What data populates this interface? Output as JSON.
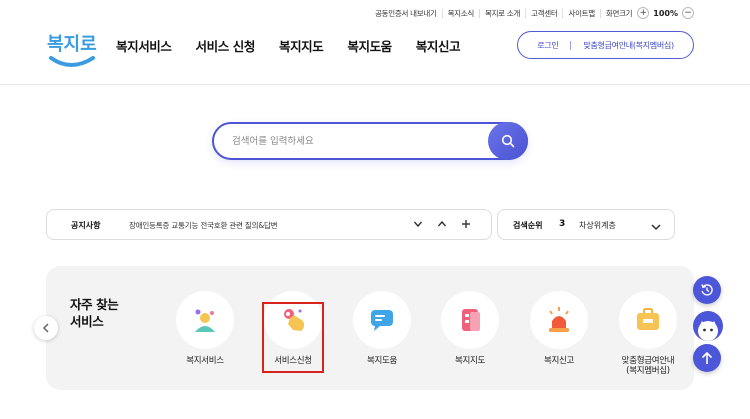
{
  "utility": {
    "links": [
      "공동인증서 내보내기",
      "복지소식",
      "복지로 소개",
      "고객센터",
      "사이트맵"
    ],
    "zoom_label": "화면크기",
    "zoom_plus": "+",
    "zoom_value": "100%",
    "zoom_minus": "−"
  },
  "header": {
    "logo_text": "복지로",
    "nav": [
      "복지서비스",
      "서비스 신청",
      "복지지도",
      "복지도움",
      "복지신고"
    ],
    "login": "로그인",
    "membership": "맞춤형급여안내(복지멤버십)"
  },
  "search": {
    "placeholder": "검색어를 입력하세요"
  },
  "notice": {
    "label": "공지사항",
    "text": "장애인등록증 교통기능 전국호환 관련 질의&답변",
    "down": "∨",
    "up": "∧",
    "add": "+"
  },
  "rank": {
    "label": "검색순위",
    "number": "3",
    "keyword": "차상위계층"
  },
  "frequent": {
    "title_line1": "자주 찾는",
    "title_line2": "서비스",
    "items": [
      {
        "label": "복지서비스",
        "icon": "person-icon"
      },
      {
        "label": "서비스신청",
        "icon": "hand-pointer-icon"
      },
      {
        "label": "복지도움",
        "icon": "chat-bubble-icon"
      },
      {
        "label": "복지지도",
        "icon": "map-card-icon"
      },
      {
        "label": "복지신고",
        "icon": "siren-icon"
      },
      {
        "label_line1": "맞춤형급여안내",
        "label_line2": "(복지멤버십)",
        "icon": "briefcase-icon"
      }
    ]
  },
  "colors": {
    "accent": "#4b55d6",
    "highlight_border": "#d8231f",
    "panel_bg": "#f3f3f3"
  }
}
